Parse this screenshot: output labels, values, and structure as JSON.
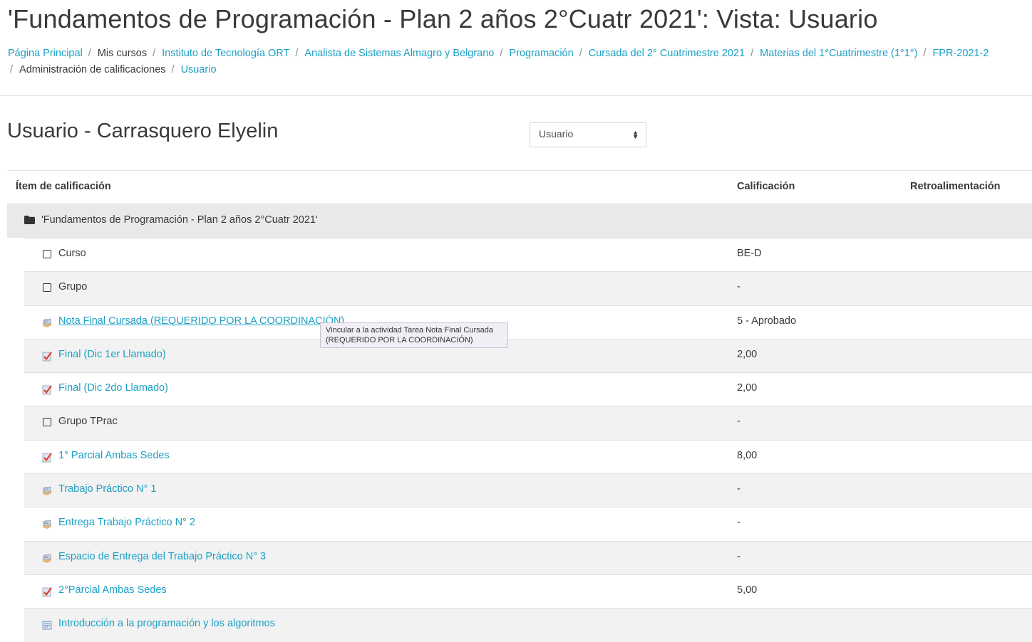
{
  "page_title": "'Fundamentos de Programación - Plan 2 años 2°Cuatr 2021': Vista: Usuario",
  "breadcrumb": {
    "line1": [
      {
        "label": "Página Principal",
        "link": true
      },
      {
        "label": "Mis cursos",
        "link": false
      },
      {
        "label": "Instituto de Tecnología ORT",
        "link": true
      },
      {
        "label": "Analista de Sistemas Almagro y Belgrano",
        "link": true
      },
      {
        "label": "Programación",
        "link": true
      },
      {
        "label": "Cursada del 2° Cuatrimestre 2021",
        "link": true
      },
      {
        "label": "Materias del 1°Cuatrimestre (1°1°)",
        "link": true
      },
      {
        "label": "FPR-2021-2",
        "link": true
      }
    ],
    "line2": [
      {
        "label": "Administración de calificaciones",
        "link": false
      },
      {
        "label": "Usuario",
        "link": true
      }
    ],
    "separator": "/"
  },
  "user_heading": "Usuario - Carrasquero Elyelin",
  "view_select": {
    "value": "Usuario"
  },
  "table": {
    "headers": {
      "item": "Ítem de calificación",
      "grade": "Calificación",
      "feedback": "Retroalimentación"
    },
    "category": "'Fundamentos de Programación - Plan 2 años 2°Cuatr 2021'",
    "rows": [
      {
        "name": "Curso",
        "grade": "BE-D",
        "icon": "checkbox-icon",
        "link": false
      },
      {
        "name": "Grupo",
        "grade": "-",
        "icon": "checkbox-icon",
        "link": false
      },
      {
        "name": "Nota Final Cursada (REQUERIDO POR LA COORDINACIÓN)",
        "grade": "5 - Aprobado",
        "icon": "assignment-icon",
        "link": true,
        "hovered": true
      },
      {
        "name": "Final (Dic 1er Llamado)",
        "grade": "2,00",
        "icon": "quiz-icon",
        "link": true
      },
      {
        "name": "Final (Dic 2do Llamado)",
        "grade": "2,00",
        "icon": "quiz-icon",
        "link": true
      },
      {
        "name": "Grupo TPrac",
        "grade": "-",
        "icon": "checkbox-icon",
        "link": false
      },
      {
        "name": "1° Parcial Ambas Sedes",
        "grade": "8,00",
        "icon": "quiz-icon",
        "link": true
      },
      {
        "name": "Trabajo Práctico N° 1",
        "grade": "-",
        "icon": "assignment-icon",
        "link": true
      },
      {
        "name": "Entrega Trabajo Práctico N° 2",
        "grade": "-",
        "icon": "assignment-icon",
        "link": true
      },
      {
        "name": "Espacio de Entrega del Trabajo Práctico N° 3",
        "grade": "-",
        "icon": "assignment-icon",
        "link": true
      },
      {
        "name": "2°Parcial Ambas Sedes",
        "grade": "5,00",
        "icon": "quiz-icon",
        "link": true
      },
      {
        "name": "Introducción a la programación y los algoritmos",
        "grade": "",
        "icon": "lesson-icon",
        "link": true
      }
    ]
  },
  "tooltip": {
    "text": "Vincular a la actividad Tarea Nota Final Cursada (REQUERIDO POR LA COORDINACIÓN)"
  },
  "colors": {
    "link": "#1ba0c4",
    "text": "#373a3c",
    "category_bg": "#e9e9e9",
    "stripe": "#f2f2f2",
    "border": "#dee2e6"
  }
}
